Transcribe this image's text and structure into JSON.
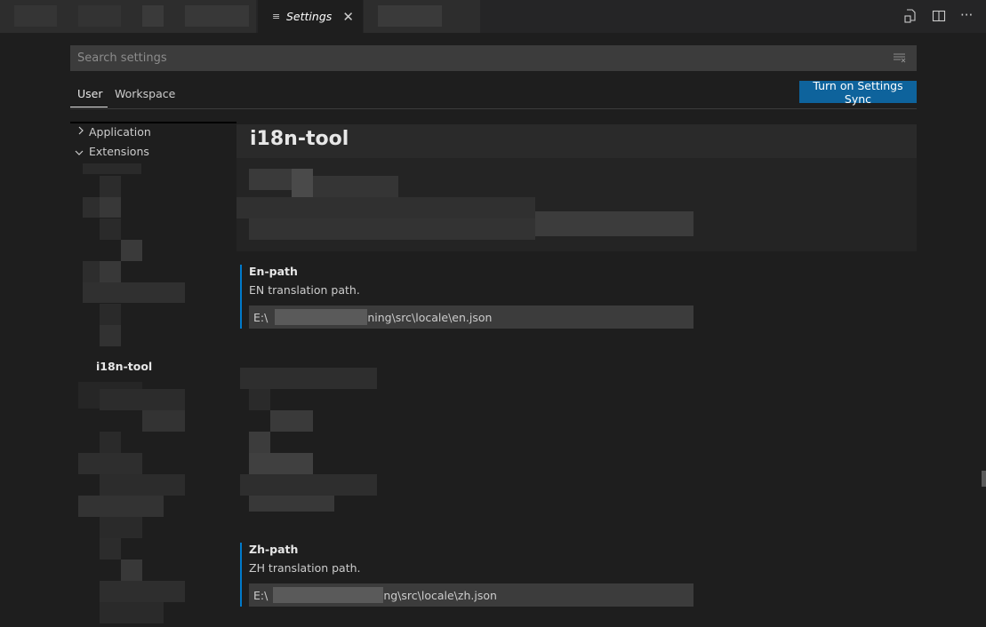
{
  "tabs": {
    "settings_label": "Settings",
    "settings_icon": "settings-file-icon",
    "close_glyph": "✕"
  },
  "editor_actions": {
    "open_json_icon": "open-settings-json-icon",
    "split_icon": "split-editor-icon",
    "more_glyph": "···"
  },
  "search": {
    "placeholder": "Search settings",
    "value": ""
  },
  "scopes": {
    "user": "User",
    "workspace": "Workspace"
  },
  "sync_button": "Turn on Settings Sync",
  "toc": {
    "application": "Application",
    "extensions": "Extensions",
    "i18n_tool": "i18n-tool"
  },
  "section": {
    "title": "i18n-tool"
  },
  "settings": [
    {
      "title": "En-path",
      "description": "EN translation path.",
      "value_prefix": "E:\\",
      "value_suffix": "ning\\src\\locale\\en.json"
    },
    {
      "title": "Zh-path",
      "description": "ZH translation path.",
      "value_prefix": "E:\\",
      "value_suffix": "ng\\src\\locale\\zh.json"
    }
  ],
  "colors": {
    "accent": "#0e639c",
    "modified_bar": "#007acc",
    "background": "#1e1e1e"
  }
}
